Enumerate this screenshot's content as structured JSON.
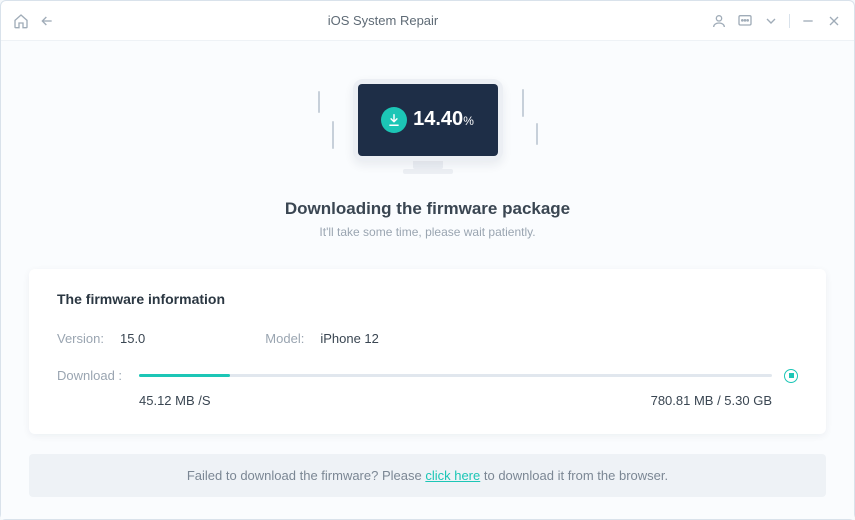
{
  "titlebar": {
    "title": "iOS System Repair"
  },
  "progress": {
    "percent_text": "14.40",
    "percent_suffix": "%"
  },
  "headline": "Downloading the firmware package",
  "subhead": "It'll take some time, please wait patiently.",
  "card": {
    "title": "The firmware information",
    "version_label": "Version:",
    "version_value": "15.0",
    "model_label": "Model:",
    "model_value": "iPhone 12",
    "download_label": "Download :",
    "speed": "45.12 MB /S",
    "size": "780.81 MB / 5.30 GB",
    "progress_percent": 14.4
  },
  "footer": {
    "prefix": "Failed to download the firmware? Please ",
    "link": "click here",
    "suffix": " to download it from the browser."
  }
}
